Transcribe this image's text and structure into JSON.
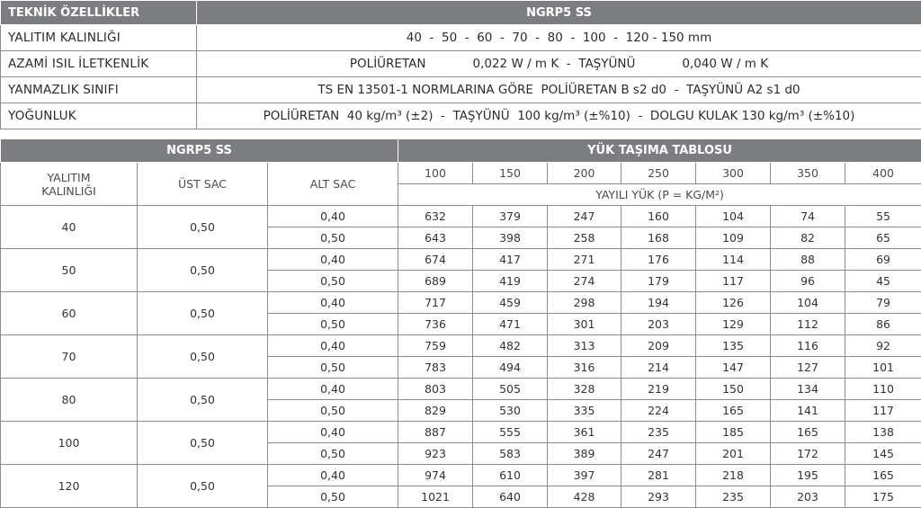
{
  "spec_table": {
    "header_label": "TEKNİK ÖZELLİKLER",
    "header_value": "NGRP5 SS",
    "rows": [
      {
        "label": "YALITIM KALINLIĞI",
        "segments": [
          "40  -  50  -  60  -  70  -  80  -  100  -  120 - 150 mm"
        ]
      },
      {
        "label": "AZAMİ ISIL İLETKENLİK",
        "segments": [
          "POLİÜRETAN",
          "0,022 W / m K  -  TAŞYÜNÜ",
          "0,040 W / m K"
        ]
      },
      {
        "label": "YANMAZLIK SINIFI",
        "segments": [
          "TS EN 13501-1 NORMLARINA GÖRE  POLİÜRETAN B s2 d0  -  TAŞYÜNÜ A2 s1 d0"
        ]
      },
      {
        "label": "YOĞUNLUK",
        "segments": [
          "POLİÜRETAN  40 kg/m³ (±2)  -  TAŞYÜNÜ  100 kg/m³ (±%10)  -  DOLGU KULAK 130 kg/m³ (±%10)"
        ]
      }
    ]
  },
  "load_table": {
    "left_title": "NGRP5 SS",
    "right_title": "YÜK TAŞIMA TABLOSU",
    "col_thickness_l1": "YALITIM",
    "col_thickness_l2": "KALINLIĞI",
    "col_upper": "ÜST SAC",
    "col_lower": "ALT SAC",
    "spans": [
      "100",
      "150",
      "200",
      "250",
      "300",
      "350",
      "400"
    ],
    "load_label": "YAYILI YÜK (P = KG/M²)",
    "groups": [
      {
        "thickness": "40",
        "upper": "0,50",
        "rows": [
          {
            "lower": "0,40",
            "values": [
              "632",
              "379",
              "247",
              "160",
              "104",
              "74",
              "55"
            ]
          },
          {
            "lower": "0,50",
            "values": [
              "643",
              "398",
              "258",
              "168",
              "109",
              "82",
              "65"
            ]
          }
        ]
      },
      {
        "thickness": "50",
        "upper": "0,50",
        "rows": [
          {
            "lower": "0,40",
            "values": [
              "674",
              "417",
              "271",
              "176",
              "114",
              "88",
              "69"
            ]
          },
          {
            "lower": "0,50",
            "values": [
              "689",
              "419",
              "274",
              "179",
              "117",
              "96",
              "45"
            ]
          }
        ]
      },
      {
        "thickness": "60",
        "upper": "0,50",
        "rows": [
          {
            "lower": "0,40",
            "values": [
              "717",
              "459",
              "298",
              "194",
              "126",
              "104",
              "79"
            ]
          },
          {
            "lower": "0,50",
            "values": [
              "736",
              "471",
              "301",
              "203",
              "129",
              "112",
              "86"
            ]
          }
        ]
      },
      {
        "thickness": "70",
        "upper": "0,50",
        "rows": [
          {
            "lower": "0,40",
            "values": [
              "759",
              "482",
              "313",
              "209",
              "135",
              "116",
              "92"
            ]
          },
          {
            "lower": "0,50",
            "values": [
              "783",
              "494",
              "316",
              "214",
              "147",
              "127",
              "101"
            ]
          }
        ]
      },
      {
        "thickness": "80",
        "upper": "0,50",
        "rows": [
          {
            "lower": "0,40",
            "values": [
              "803",
              "505",
              "328",
              "219",
              "150",
              "134",
              "110"
            ]
          },
          {
            "lower": "0,50",
            "values": [
              "829",
              "530",
              "335",
              "224",
              "165",
              "141",
              "117"
            ]
          }
        ]
      },
      {
        "thickness": "100",
        "upper": "0,50",
        "rows": [
          {
            "lower": "0,40",
            "values": [
              "887",
              "555",
              "361",
              "235",
              "185",
              "165",
              "138"
            ]
          },
          {
            "lower": "0,50",
            "values": [
              "923",
              "583",
              "389",
              "247",
              "201",
              "172",
              "145"
            ]
          }
        ]
      },
      {
        "thickness": "120",
        "upper": "0,50",
        "rows": [
          {
            "lower": "0,40",
            "values": [
              "974",
              "610",
              "397",
              "281",
              "218",
              "195",
              "165"
            ]
          },
          {
            "lower": "0,50",
            "values": [
              "1021",
              "640",
              "428",
              "293",
              "235",
              "203",
              "175"
            ]
          }
        ]
      }
    ]
  }
}
